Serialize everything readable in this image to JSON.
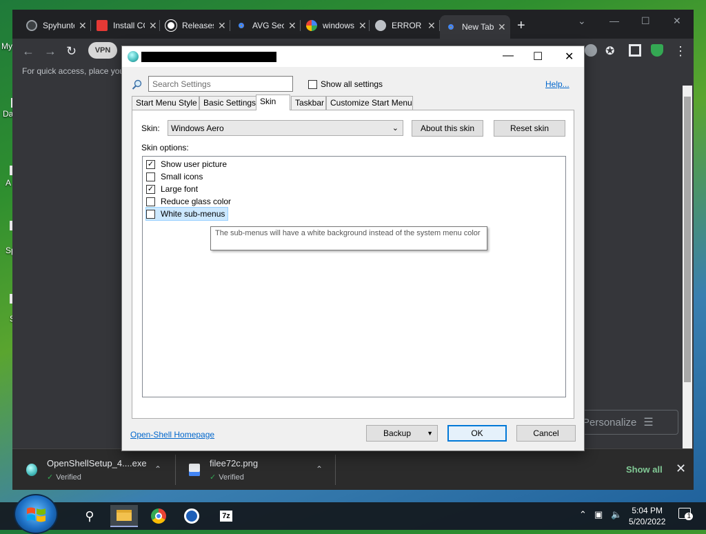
{
  "desktop": {
    "labels": [
      "My",
      "Da",
      "A",
      "Sp",
      "S"
    ]
  },
  "browser": {
    "tabs": [
      {
        "label": "Spyhunter",
        "favicon_color": "#3c4043"
      },
      {
        "label": "Install CCleaner",
        "favicon_color": "#e53935"
      },
      {
        "label": "Releases",
        "favicon_color": "#ffffff"
      },
      {
        "label": "AVG Secure",
        "favicon_color": "#5b8def"
      },
      {
        "label": "windows",
        "favicon_color": "#4285f4"
      },
      {
        "label": "ERROR",
        "favicon_color": "#bdc1c6"
      },
      {
        "label": "New Tab",
        "favicon_color": "#5b8def"
      }
    ],
    "close_glyph": "✕",
    "new_tab_glyph": "+",
    "vpn_label": "VPN",
    "bookmarks_hint": "For quick access, place you",
    "personalize_label": "Personalize",
    "downloads": [
      {
        "name": "OpenShellSetup_4....exe",
        "status": "Verified"
      },
      {
        "name": "filee72c.png",
        "status": "Verified"
      }
    ],
    "show_all": "Show all"
  },
  "dialog": {
    "search_placeholder": "Search Settings",
    "show_all_settings": "Show all settings",
    "help": "Help...",
    "tabs": [
      "Start Menu Style",
      "Basic Settings",
      "Skin",
      "Taskbar",
      "Customize Start Menu"
    ],
    "selected_tab": "Skin",
    "skin_label": "Skin:",
    "skin_value": "Windows Aero",
    "about_skin": "About this skin",
    "reset_skin": "Reset skin",
    "skin_options_label": "Skin options:",
    "options": [
      {
        "label": "Show user picture",
        "checked": true
      },
      {
        "label": "Small icons",
        "checked": false
      },
      {
        "label": "Large font",
        "checked": true
      },
      {
        "label": "Reduce glass color",
        "checked": false
      },
      {
        "label": "White sub-menus",
        "checked": false
      }
    ],
    "tooltip": "The sub-menus will have a white background instead of the system menu color",
    "homepage_link": "Open-Shell Homepage",
    "backup": "Backup",
    "ok": "OK",
    "cancel": "Cancel"
  },
  "taskbar": {
    "time": "5:04 PM",
    "date": "5/20/2022",
    "notification_count": "1",
    "zip_label": "7z"
  }
}
